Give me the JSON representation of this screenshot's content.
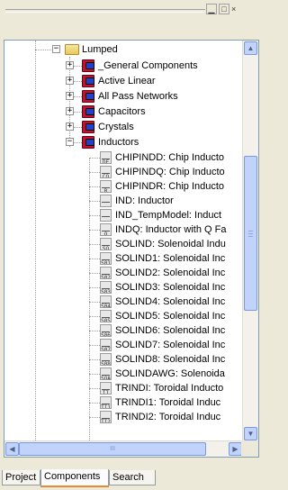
{
  "window": {
    "minimize_glyph": "▁",
    "maximize_glyph": "□",
    "close_glyph": "×"
  },
  "tree": {
    "root": {
      "label": "Lumped",
      "expanded": true,
      "expander": "−"
    },
    "categories": [
      {
        "label": "_General Components",
        "expander": "+"
      },
      {
        "label": "Active Linear",
        "expander": "+"
      },
      {
        "label": "All Pass Networks",
        "expander": "+"
      },
      {
        "label": "Capacitors",
        "expander": "+"
      },
      {
        "label": "Crystals",
        "expander": "+"
      },
      {
        "label": "Inductors",
        "expander": "−"
      }
    ],
    "inductors": [
      {
        "label": "CHIPINDD: Chip Inducto",
        "icon_text": "DF"
      },
      {
        "label": "CHIPINDQ: Chip Inducto",
        "icon_text": "CQ"
      },
      {
        "label": "CHIPINDR: Chip Inducto",
        "icon_text": "R"
      },
      {
        "label": "IND: Inductor",
        "icon_text": ""
      },
      {
        "label": "IND_TempModel: Induct",
        "icon_text": ""
      },
      {
        "label": "INDQ: Inductor with Q Fa",
        "icon_text": "Q"
      },
      {
        "label": "SOLIND: Solenoidal Indu",
        "icon_text": "SO"
      },
      {
        "label": "SOLIND1: Solenoidal Inc",
        "icon_text": "S01"
      },
      {
        "label": "SOLIND2: Solenoidal Inc",
        "icon_text": "S02"
      },
      {
        "label": "SOLIND3: Solenoidal Inc",
        "icon_text": "S03"
      },
      {
        "label": "SOLIND4: Solenoidal Inc",
        "icon_text": "S04"
      },
      {
        "label": "SOLIND5: Solenoidal Inc",
        "icon_text": "S05"
      },
      {
        "label": "SOLIND6: Solenoidal Inc",
        "icon_text": "S06"
      },
      {
        "label": "SOLIND7: Solenoidal Inc",
        "icon_text": "S07"
      },
      {
        "label": "SOLIND8: Solenoidal Inc",
        "icon_text": "S08"
      },
      {
        "label": "SOLINDAWG: Solenoida",
        "icon_text": "SOA"
      },
      {
        "label": "TRINDI: Toroidal Inducto",
        "icon_text": "TI"
      },
      {
        "label": "TRINDI1: Toroidal Induc",
        "icon_text": "TI1"
      },
      {
        "label": "TRINDI2: Toroidal Induc",
        "icon_text": "TI2"
      }
    ]
  },
  "scrollbars": {
    "up_glyph": "▲",
    "down_glyph": "▼",
    "left_glyph": "◀",
    "right_glyph": "▶",
    "h_thumb_grip": "III"
  },
  "tabs": [
    {
      "label": "Project",
      "active": false
    },
    {
      "label": "Components",
      "active": true
    },
    {
      "label": "Search",
      "active": false
    }
  ]
}
